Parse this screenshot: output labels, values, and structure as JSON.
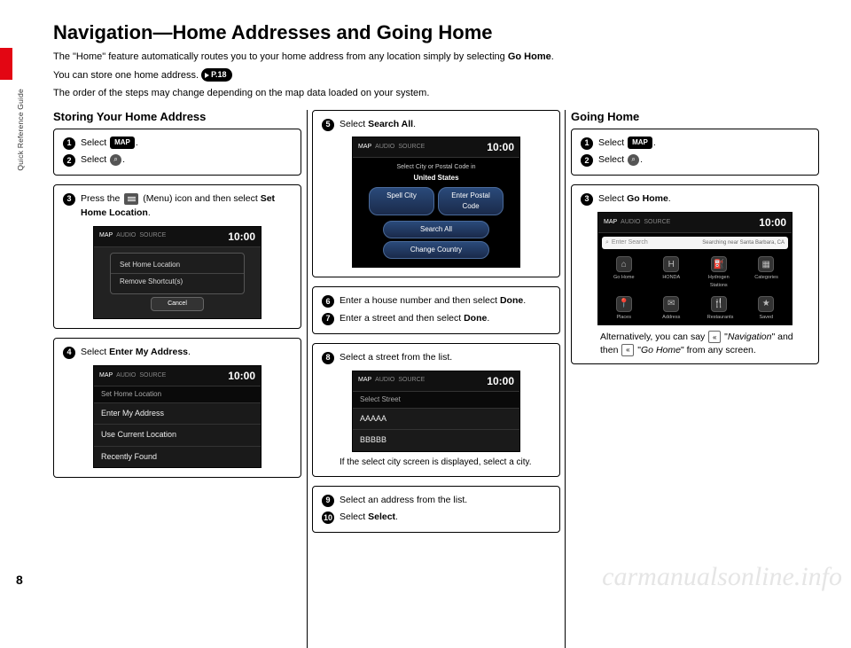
{
  "sideLabel": "Quick Reference Guide",
  "pageNumber": "8",
  "watermark": "carmanualsonline.info",
  "title": "Navigation—Home Addresses and Going Home",
  "intro": {
    "line1a": "The \"Home\" feature automatically routes you to your home address from any location simply by selecting ",
    "line1b": "Go Home",
    "line1c": ".",
    "line2a": "You can store one home address. ",
    "pageRef": "P.18",
    "line3": "The order of the steps may change depending on the map data loaded on your system."
  },
  "col1": {
    "heading": "Storing Your Home Address",
    "box1": {
      "s1a": "Select ",
      "s1chip": "MAP",
      "s1b": ".",
      "s2a": "Select ",
      "s2icon": "⌕",
      "s2b": "."
    },
    "box2": {
      "s3a": "Press the ",
      "s3menu": "MENU",
      "s3b": " (Menu) icon and then select ",
      "s3c": "Set Home Location",
      "s3d": ".",
      "screen": {
        "tabs": [
          "MAP",
          "AUDIO",
          "SOURCE"
        ],
        "clock": "10:00",
        "popup": [
          "Set Home Location",
          "Remove Shortcut(s)"
        ],
        "cancel": "Cancel"
      }
    },
    "box3": {
      "s4a": "Select ",
      "s4b": "Enter My Address",
      "s4c": ".",
      "screen": {
        "tabs": [
          "MAP",
          "AUDIO",
          "SOURCE"
        ],
        "clock": "10:00",
        "header": "Set Home Location",
        "items": [
          "Enter My Address",
          "Use Current Location",
          "Recently Found"
        ]
      }
    }
  },
  "col2": {
    "box1": {
      "s5a": "Select ",
      "s5b": "Search All",
      "s5c": ".",
      "screen": {
        "tabs": [
          "MAP",
          "AUDIO",
          "SOURCE"
        ],
        "clock": "10:00",
        "subheadA": "Select City or Postal Code in",
        "subheadB": "United States",
        "rowA": "Spell City",
        "rowB": "Enter Postal Code",
        "searchAll": "Search All",
        "changeCountry": "Change Country"
      }
    },
    "box2": {
      "s6a": "Enter a house number and then select ",
      "s6b": "Done",
      "s6c": ".",
      "s7a": "Enter a street and then select ",
      "s7b": "Done",
      "s7c": "."
    },
    "box3": {
      "s8": "Select a street from the list.",
      "screen": {
        "tabs": [
          "MAP",
          "AUDIO",
          "SOURCE"
        ],
        "clock": "10:00",
        "header": "Select Street",
        "items": [
          "AAAAA",
          "BBBBB"
        ]
      },
      "sub": "If the select city screen is displayed, select a city."
    },
    "box4": {
      "s9": "Select an address from the list.",
      "s10a": "Select ",
      "s10b": "Select",
      "s10c": "."
    }
  },
  "col3": {
    "heading": "Going Home",
    "box1": {
      "s1a": "Select ",
      "s1chip": "MAP",
      "s1b": ".",
      "s2a": "Select ",
      "s2icon": "⌕",
      "s2b": "."
    },
    "box2": {
      "s3a": "Select ",
      "s3b": "Go Home",
      "s3c": ".",
      "screen": {
        "tabs": [
          "MAP",
          "AUDIO",
          "SOURCE"
        ],
        "clock": "10:00",
        "searchPlaceholder": "Enter Search",
        "searchLoc": "Searching near Santa Barbara, CA",
        "row1": [
          {
            "glyph": "⌂",
            "label": "Go Home"
          },
          {
            "glyph": "H",
            "label": "HONDA"
          },
          {
            "glyph": "⛽",
            "label": "Hydrogen Stations"
          },
          {
            "glyph": "▦",
            "label": "Categories"
          }
        ],
        "row2": [
          {
            "glyph": "📍",
            "label": "Places"
          },
          {
            "glyph": "✉",
            "label": "Address"
          },
          {
            "glyph": "🍴",
            "label": "Restaurants"
          },
          {
            "glyph": "★",
            "label": "Saved"
          }
        ]
      },
      "noteA": "Alternatively, you can say ",
      "noteB": "\"",
      "noteC": "Navigation",
      "noteD": "\" and then ",
      "noteE": " \"",
      "noteF": "Go Home",
      "noteG": "\" from any screen."
    }
  }
}
